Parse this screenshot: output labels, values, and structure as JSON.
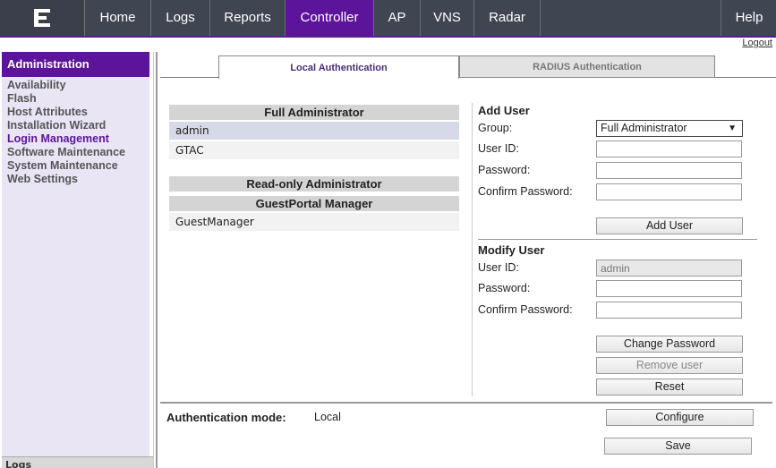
{
  "nav": {
    "items": [
      {
        "label": "Home"
      },
      {
        "label": "Logs"
      },
      {
        "label": "Reports"
      },
      {
        "label": "Controller"
      },
      {
        "label": "AP"
      },
      {
        "label": "VNS"
      },
      {
        "label": "Radar"
      },
      {
        "label": "Help"
      }
    ],
    "active": "Controller",
    "logout": "Logout",
    "logo_icon": "extreme-networks-logo"
  },
  "sidebar": {
    "title": "Administration",
    "items": [
      {
        "label": "Availability"
      },
      {
        "label": "Flash"
      },
      {
        "label": "Host Attributes"
      },
      {
        "label": "Installation Wizard"
      },
      {
        "label": "Login Management"
      },
      {
        "label": "Software Maintenance"
      },
      {
        "label": "System Maintenance"
      },
      {
        "label": "Web Settings"
      }
    ],
    "current": "Login Management",
    "bottom_label": "Logs"
  },
  "tabs": [
    {
      "label": "Local Authentication",
      "active": true
    },
    {
      "label": "RADIUS Authentication",
      "active": false
    }
  ],
  "groups": {
    "full_admin": {
      "title": "Full Administrator",
      "users": [
        "admin",
        "GTAC"
      ]
    },
    "readonly_admin": {
      "title": "Read-only Administrator"
    },
    "guestportal": {
      "title": "GuestPortal Manager",
      "users": [
        "GuestManager"
      ]
    }
  },
  "add_user": {
    "title": "Add User",
    "group_label": "Group:",
    "group_value": "Full Administrator",
    "userid_label": "User ID:",
    "password_label": "Password:",
    "confirm_label": "Confirm Password:",
    "button": "Add User"
  },
  "modify_user": {
    "title": "Modify User",
    "userid_label": "User ID:",
    "userid_value": "admin",
    "password_label": "Password:",
    "confirm_label": "Confirm Password:",
    "change_button": "Change Password",
    "remove_button": "Remove user",
    "reset_button": "Reset"
  },
  "auth": {
    "label": "Authentication mode:",
    "value": "Local",
    "configure_button": "Configure",
    "save_button": "Save"
  },
  "colors": {
    "accent": "#5c149a",
    "nav_bg": "#404552"
  }
}
